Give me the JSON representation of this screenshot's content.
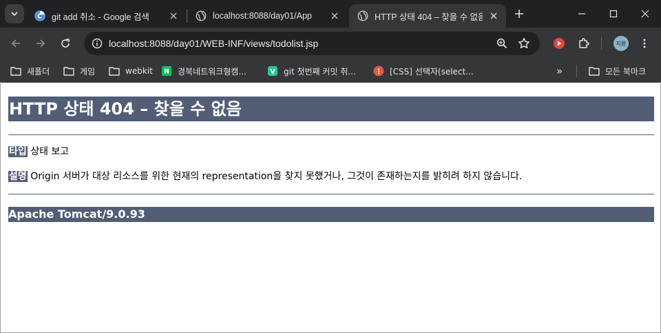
{
  "tabs": [
    {
      "title": "git add 취소 - Google 검색",
      "favicon": "google-icon",
      "active": false
    },
    {
      "title": "localhost:8088/day01/App",
      "favicon": "globe-icon",
      "active": false
    },
    {
      "title": "HTTP 상태 404 – 찾을 수 없음",
      "favicon": "globe-icon",
      "active": true
    }
  ],
  "toolbar": {
    "url": "localhost:8088/day01/WEB-INF/views/todolist.jsp",
    "profile_initial": "지환"
  },
  "bookmarks": {
    "items": [
      {
        "label": "새폴더",
        "icon": "folder-icon"
      },
      {
        "label": "게임",
        "icon": "folder-icon"
      },
      {
        "label": "webkit",
        "icon": "folder-icon"
      },
      {
        "label": "경북네트워크형캠...",
        "icon": "naver-icon"
      },
      {
        "label": "git 첫번째 커밋 취...",
        "icon": "velog-icon"
      },
      {
        "label": "[CSS] 선택자(select...",
        "icon": "tistory-icon"
      }
    ],
    "overflow": "»",
    "all_bookmarks": "모든 북마크"
  },
  "page": {
    "heading": "HTTP 상태 404 – 찾을 수 없음",
    "type_label": "타입",
    "type_value": "상태 보고",
    "desc_label": "설명",
    "desc_value": "Origin 서버가 대상 리소스를 위한 현재의 representation을 찾지 못했거나, 그것이 존재하는지를 밝히려 하지 않습니다.",
    "footer": "Apache Tomcat/9.0.93"
  },
  "colors": {
    "tomcat_banner": "#525d76",
    "chrome_dark": "#202124",
    "chrome_toolbar": "#35363a"
  }
}
